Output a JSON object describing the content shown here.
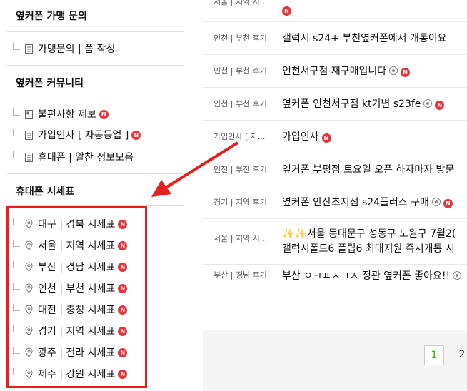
{
  "sidebar": {
    "section1": {
      "title": "옆커폰 가맹 문의",
      "items": [
        {
          "label": "가맹문의 | 폼 작성",
          "new": false
        }
      ]
    },
    "section2": {
      "title": "옆커폰 커뮤니티",
      "items": [
        {
          "label": "불편사항 제보",
          "new": true
        },
        {
          "label": "가입인사 [ 자동등업 ]",
          "new": true
        },
        {
          "label": "휴대폰 | 알찬 정보모음",
          "new": false
        }
      ]
    },
    "section3": {
      "title": "휴대폰 시세표",
      "items": [
        {
          "label": "대구 | 경북 시세표",
          "new": true
        },
        {
          "label": "서울 | 지역 시세표",
          "new": true
        },
        {
          "label": "부산 | 경남 시세표",
          "new": true
        },
        {
          "label": "인천 | 부천 시세표",
          "new": true
        },
        {
          "label": "대전 | 충청 시세표",
          "new": true
        },
        {
          "label": "경기 | 지역 시세표",
          "new": true
        },
        {
          "label": "광주 | 전라 시세표",
          "new": true
        },
        {
          "label": "제주 | 강원 시세표",
          "new": true
        }
      ]
    },
    "new_badge": "N"
  },
  "posts": [
    {
      "category": "서울 | 지역 시...",
      "title": "",
      "new": true,
      "camera": false
    },
    {
      "category": "인천 | 부천 후기",
      "title": "갤럭시 s24+ 부천옆커폰에서 개통이요",
      "new": false,
      "camera": false
    },
    {
      "category": "인천 | 부천 후기",
      "title": "인천서구점 재구매입니다",
      "new": true,
      "camera": true
    },
    {
      "category": "인천 | 부천 후기",
      "title": "옆커폰 인천서구점 kt기변 s23fe",
      "new": true,
      "camera": true
    },
    {
      "category": "가입인사 [ 자...",
      "title": "가입인사",
      "new": true,
      "camera": false
    },
    {
      "category": "인천 | 부천 후기",
      "title": "옆커폰 부평점 토요일 오픈 하자마자 방문",
      "new": false,
      "camera": false
    },
    {
      "category": "경기 | 지역 후기",
      "title": "옆커폰 안산초지점 s24플러스 구매",
      "new": true,
      "camera": true
    },
    {
      "category": "서울 | 지역 시...",
      "title": "✨✨서울 동대문구 성동구 노원구 7월2(",
      "title2": "갤럭시폴드6 플립6 최대지원 즉시개통 시",
      "new": false,
      "camera": false
    },
    {
      "category": "부산 | 경남 후기",
      "title": "부산 ㅇㅋㅍㅈㄱㅈ 정관 옆커폰 좋아요!!",
      "new": false,
      "camera": true
    }
  ],
  "pagination": {
    "current": "1",
    "next": "2"
  },
  "colors": {
    "badge": "#e8333b",
    "highlight": "#e3211f",
    "page_active": "#2db400"
  }
}
